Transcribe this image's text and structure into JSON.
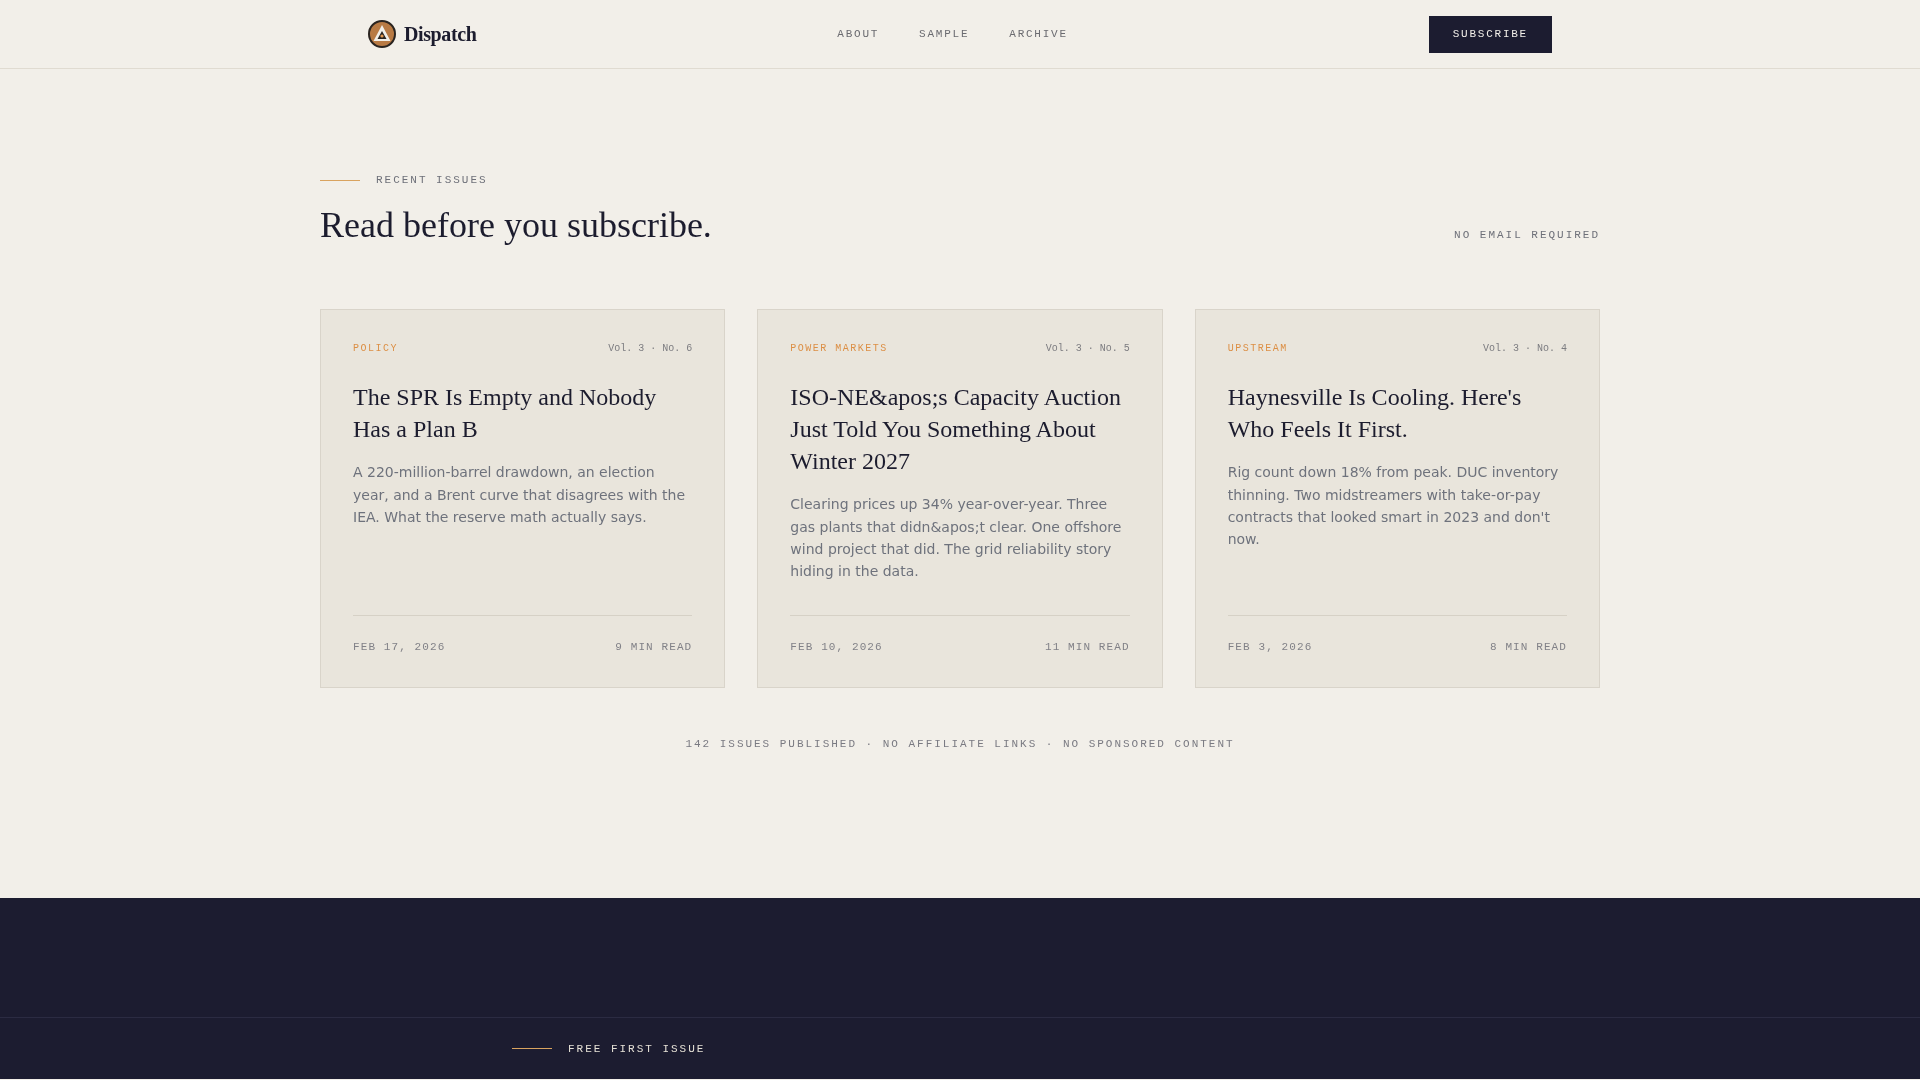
{
  "header": {
    "brand": "Dispatch",
    "nav": [
      "ABOUT",
      "SAMPLE",
      "ARCHIVE"
    ],
    "subscribe_button": "SUBSCRIBE"
  },
  "recent_issues": {
    "eyebrow": "RECENT ISSUES",
    "heading": "Read before you subscribe.",
    "note": "NO EMAIL REQUIRED",
    "issues": [
      {
        "category": "POLICY",
        "issue_number": "Vol. 3 · No. 6",
        "title": "The SPR Is Empty and Nobody Has a Plan B",
        "summary": "A 220-million-barrel drawdown, an election year, and a Brent curve that disagrees with the IEA. What the reserve math actually says.",
        "date": "FEB 17, 2026",
        "read_time": "9 MIN READ"
      },
      {
        "category": "POWER MARKETS",
        "issue_number": "Vol. 3 · No. 5",
        "title": "ISO-NE&apos;s Capacity Auction Just Told You Something About Winter 2027",
        "summary": "Clearing prices up 34% year-over-year. Three gas plants that didn&apos;t clear. One offshore wind project that did. The grid reliability story hiding in the data.",
        "date": "FEB 10, 2026",
        "read_time": "11 MIN READ"
      },
      {
        "category": "UPSTREAM",
        "issue_number": "Vol. 3 · No. 4",
        "title": "Haynesville Is Cooling. Here's Who Feels It First.",
        "summary": "Rig count down 18% from peak. DUC inventory thinning. Two midstreamers with take-or-pay contracts that looked smart in 2023 and don't now.",
        "date": "FEB 3, 2026",
        "read_time": "8 MIN READ"
      }
    ],
    "stats": "142 ISSUES PUBLISHED · NO AFFILIATE LINKS · NO SPONSORED CONTENT"
  },
  "signup": {
    "eyebrow": "FREE FIRST ISSUE"
  }
}
